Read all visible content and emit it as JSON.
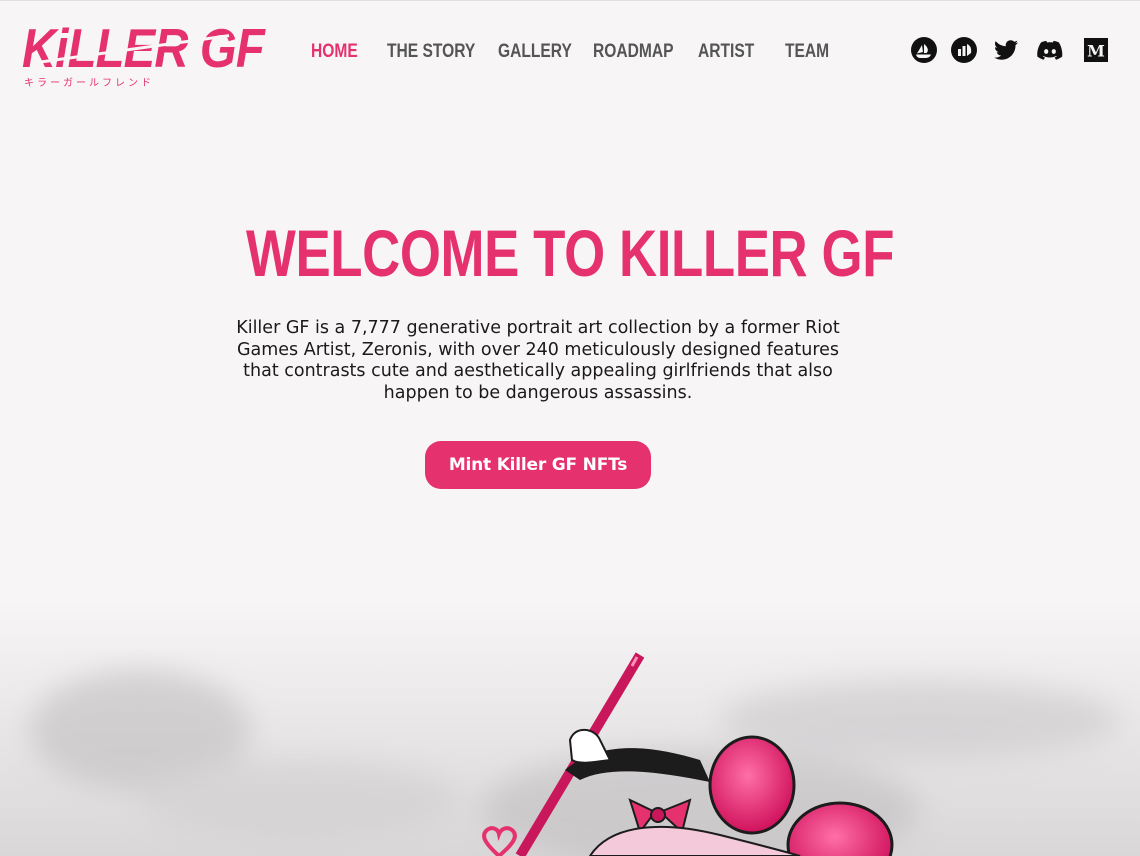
{
  "brand": {
    "logo_text": "KiLLER GF",
    "logo_subtitle": "キラーガールフレンド",
    "accent": "#e6316f"
  },
  "nav": {
    "items": [
      {
        "label": "HOME",
        "active": true
      },
      {
        "label": "THE STORY",
        "active": false
      },
      {
        "label": "GALLERY",
        "active": false
      },
      {
        "label": "ROADMAP",
        "active": false
      },
      {
        "label": "ARTIST",
        "active": false
      },
      {
        "label": "TEAM",
        "active": false
      }
    ]
  },
  "socials": [
    {
      "icon": "opensea-icon"
    },
    {
      "icon": "stats-icon"
    },
    {
      "icon": "twitter-icon"
    },
    {
      "icon": "discord-icon"
    },
    {
      "icon": "medium-icon"
    }
  ],
  "hero": {
    "title": "WELCOME TO KILLER GF",
    "description": "Killer GF is a 7,777 generative portrait art collection by a former Riot Games Artist, Zeronis, with over 240 meticulously designed features that contrasts cute and aesthetically appealing girlfriends that also happen to be dangerous assassins.",
    "cta_label": "Mint Killer GF NFTs"
  },
  "colors": {
    "background": "#f7f5f6",
    "nav_text": "#555555",
    "body_text": "#1a1a1a"
  }
}
